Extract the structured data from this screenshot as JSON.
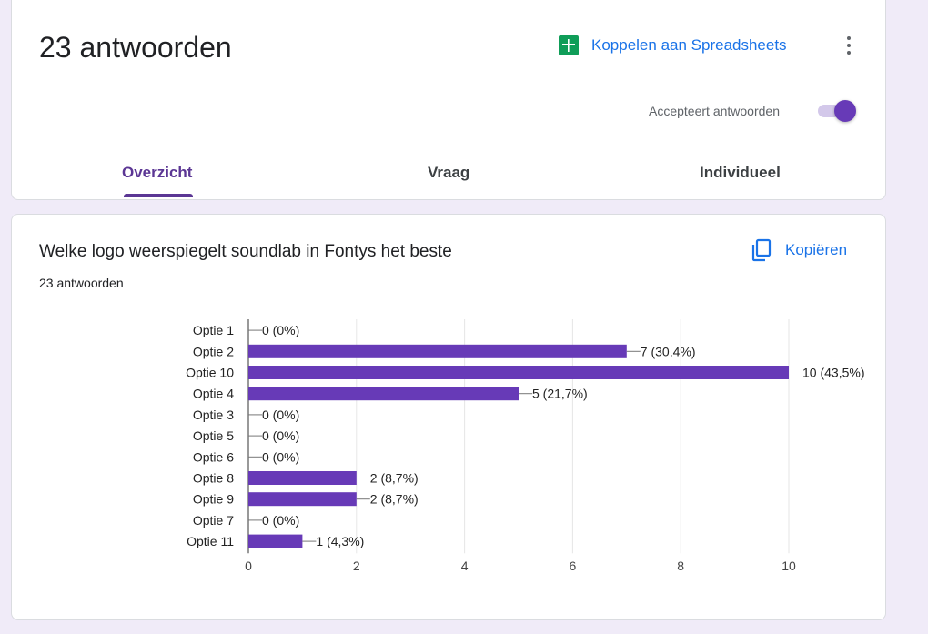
{
  "summary": {
    "responses_title": "23 antwoorden",
    "sheets_link": "Koppelen aan Spreadsheets",
    "sheets_icon": "sheets-icon",
    "more_icon": "more-vert-icon",
    "accepting_label": "Accepteert antwoorden",
    "accepting_on": true,
    "tabs": [
      "Overzicht",
      "Vraag",
      "Individueel"
    ],
    "active_tab": "Overzicht",
    "accent_color": "#673ab7",
    "link_color": "#1a73e8"
  },
  "question": {
    "title": "Welke logo weerspiegelt soundlab in Fontys het beste",
    "count": "23 antwoorden",
    "copy_label": "Kopiëren",
    "copy_icon": "copy-icon"
  },
  "chart_data": {
    "type": "bar",
    "orientation": "horizontal",
    "categories": [
      "Optie 1",
      "Optie 2",
      "Optie 10",
      "Optie 4",
      "Optie 3",
      "Optie 5",
      "Optie 6",
      "Optie 8",
      "Optie 9",
      "Optie 7",
      "Optie 11"
    ],
    "values": [
      0,
      7,
      10,
      5,
      0,
      0,
      0,
      2,
      2,
      0,
      1
    ],
    "data_labels": [
      "0 (0%)",
      "7 (30,4%)",
      "10 (43,5%)",
      "5 (21,7%)",
      "0 (0%)",
      "0 (0%)",
      "0 (0%)",
      "2 (8,7%)",
      "2 (8,7%)",
      "0 (0%)",
      "1 (4,3%)"
    ],
    "xlim": [
      0,
      10
    ],
    "xticks": [
      "0",
      "2",
      "4",
      "6",
      "8",
      "10"
    ],
    "grid": true,
    "bar_color": "#673ab7"
  }
}
